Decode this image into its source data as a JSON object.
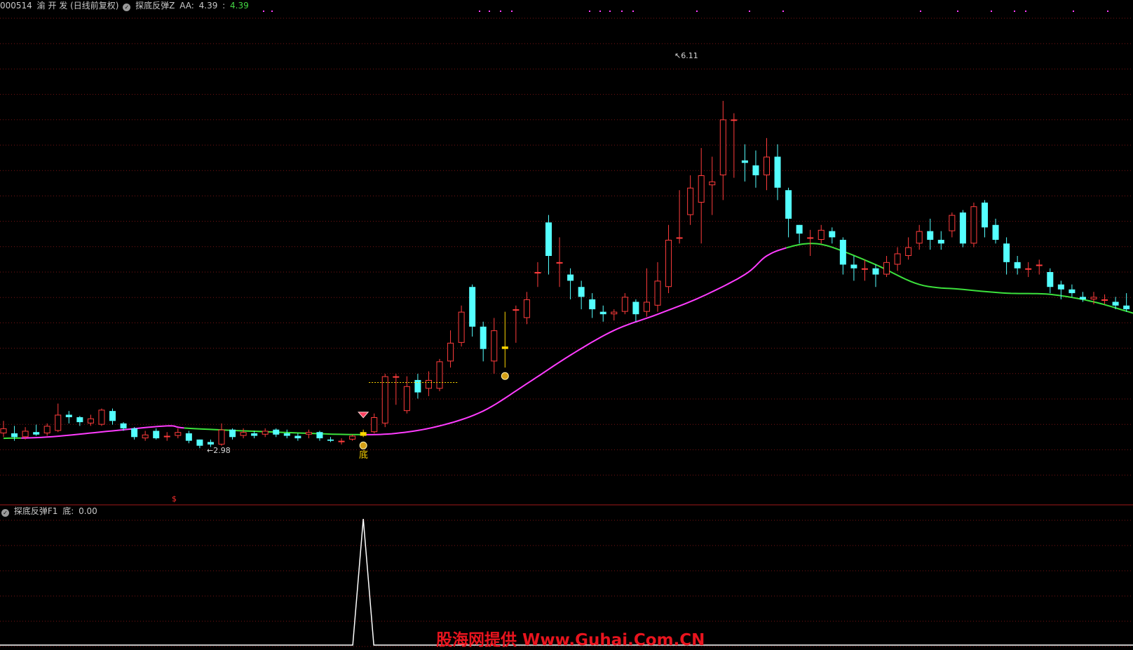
{
  "header": {
    "code": "000514",
    "name": "渝 开 发",
    "mode": "(日线前复权)",
    "indicator": "探底反弹Z",
    "aa_label": "AA:",
    "aa_value1": "4.39",
    "aa_value2": "4.39"
  },
  "subheader": {
    "indicator": "探底反弹F1",
    "label": "底:",
    "value": "0.00"
  },
  "annotations": {
    "high": "6.11",
    "low": "2.98",
    "signal_char": "底",
    "dollar": "$"
  },
  "watermark": "股海网提供 Www.Guhai.Com.CN",
  "colors": {
    "up": "#ff3c3c",
    "down": "#54ffff",
    "signal": "#ffd700",
    "ma_up": "#ff3cff",
    "ma_down": "#3ce13c",
    "grid": "#7a1414",
    "indicator_line": "#ffffff"
  },
  "chart_data": {
    "type": "candlestick",
    "price_range": [
      2.5,
      6.4
    ],
    "candles": [
      [
        3.02,
        3.06,
        3.12,
        2.99
      ],
      [
        3.02,
        2.99,
        3.08,
        2.96
      ],
      [
        2.99,
        3.04,
        3.07,
        2.97
      ],
      [
        3.03,
        3.01,
        3.09,
        3.0
      ],
      [
        3.02,
        3.08,
        3.1,
        3.0
      ],
      [
        3.04,
        3.17,
        3.26,
        3.03
      ],
      [
        3.17,
        3.15,
        3.2,
        3.1
      ],
      [
        3.15,
        3.11,
        3.16,
        3.08
      ],
      [
        3.1,
        3.14,
        3.17,
        3.08
      ],
      [
        3.09,
        3.21,
        3.22,
        3.08
      ],
      [
        3.2,
        3.12,
        3.22,
        3.09
      ],
      [
        3.1,
        3.06,
        3.11,
        3.04
      ],
      [
        3.06,
        2.99,
        3.07,
        2.97
      ],
      [
        2.98,
        3.01,
        3.04,
        2.96
      ],
      [
        3.04,
        2.98,
        3.06,
        2.97
      ],
      [
        2.99,
        3.0,
        3.03,
        2.96
      ],
      [
        3.0,
        3.03,
        3.06,
        2.98
      ],
      [
        3.02,
        2.96,
        3.04,
        2.94
      ],
      [
        2.97,
        2.92,
        2.97,
        2.9
      ],
      [
        2.95,
        2.93,
        2.97,
        2.91
      ],
      [
        2.93,
        3.05,
        3.1,
        2.92
      ],
      [
        3.05,
        2.99,
        3.06,
        2.97
      ],
      [
        3.0,
        3.03,
        3.06,
        2.98
      ],
      [
        3.02,
        3.0,
        3.04,
        2.98
      ],
      [
        3.01,
        3.04,
        3.06,
        2.99
      ],
      [
        3.05,
        3.01,
        3.06,
        2.99
      ],
      [
        3.02,
        3.0,
        3.05,
        2.98
      ],
      [
        3.0,
        2.98,
        3.02,
        2.96
      ],
      [
        3.01,
        3.03,
        3.05,
        2.98
      ],
      [
        3.03,
        2.98,
        3.04,
        2.96
      ],
      [
        2.97,
        2.96,
        2.99,
        2.95
      ],
      [
        2.96,
        2.96,
        2.98,
        2.93
      ],
      [
        2.97,
        3.0,
        3.01,
        2.96
      ],
      [
        3.0,
        3.03,
        3.05,
        2.99
      ],
      [
        3.03,
        3.15,
        3.18,
        3.02
      ],
      [
        3.1,
        3.48,
        3.5,
        3.07
      ],
      [
        3.48,
        3.48,
        3.5,
        3.25
      ],
      [
        3.2,
        3.4,
        3.48,
        3.18
      ],
      [
        3.45,
        3.35,
        3.5,
        3.3
      ],
      [
        3.38,
        3.45,
        3.52,
        3.32
      ],
      [
        3.38,
        3.6,
        3.62,
        3.36
      ],
      [
        3.6,
        3.75,
        3.85,
        3.55
      ],
      [
        3.75,
        4.0,
        4.05,
        3.72
      ],
      [
        4.2,
        3.88,
        4.22,
        3.8
      ],
      [
        3.88,
        3.7,
        3.92,
        3.6
      ],
      [
        3.6,
        3.85,
        3.95,
        3.5
      ],
      [
        3.72,
        3.7,
        4.0,
        3.55
      ],
      [
        4.02,
        4.02,
        4.05,
        3.75
      ],
      [
        3.95,
        4.1,
        4.16,
        3.9
      ],
      [
        4.32,
        4.32,
        4.4,
        4.2
      ],
      [
        4.72,
        4.45,
        4.78,
        4.3
      ],
      [
        4.4,
        4.4,
        4.6,
        4.2
      ],
      [
        4.3,
        4.25,
        4.35,
        4.1
      ],
      [
        4.2,
        4.12,
        4.25,
        4.02
      ],
      [
        4.1,
        4.02,
        4.15,
        3.95
      ],
      [
        4.0,
        3.98,
        4.05,
        3.92
      ],
      [
        3.98,
        4.0,
        4.02,
        3.93
      ],
      [
        4.0,
        4.12,
        4.15,
        3.98
      ],
      [
        4.08,
        3.98,
        4.1,
        3.92
      ],
      [
        4.0,
        4.08,
        4.35,
        3.96
      ],
      [
        4.05,
        4.25,
        4.4,
        4.0
      ],
      [
        4.2,
        4.58,
        4.7,
        4.15
      ],
      [
        4.6,
        4.6,
        4.98,
        4.55
      ],
      [
        4.78,
        5.0,
        5.1,
        4.7
      ],
      [
        4.88,
        5.1,
        5.32,
        4.55
      ],
      [
        5.02,
        5.05,
        5.25,
        4.78
      ],
      [
        5.1,
        5.55,
        5.7,
        4.9
      ],
      [
        5.55,
        5.55,
        5.6,
        5.08
      ],
      [
        5.22,
        5.2,
        5.35,
        5.05
      ],
      [
        5.18,
        5.1,
        5.3,
        5.0
      ],
      [
        5.1,
        5.25,
        5.4,
        4.98
      ],
      [
        5.25,
        5.0,
        5.35,
        4.9
      ],
      [
        4.98,
        4.75,
        5.0,
        4.6
      ],
      [
        4.7,
        4.63,
        4.7,
        4.55
      ],
      [
        4.6,
        4.6,
        4.66,
        4.45
      ],
      [
        4.58,
        4.66,
        4.7,
        4.55
      ],
      [
        4.65,
        4.6,
        4.68,
        4.55
      ],
      [
        4.58,
        4.38,
        4.6,
        4.3
      ],
      [
        4.38,
        4.35,
        4.45,
        4.25
      ],
      [
        4.35,
        4.35,
        4.42,
        4.25
      ],
      [
        4.35,
        4.3,
        4.38,
        4.2
      ],
      [
        4.3,
        4.4,
        4.45,
        4.28
      ],
      [
        4.38,
        4.47,
        4.52,
        4.33
      ],
      [
        4.45,
        4.52,
        4.6,
        4.42
      ],
      [
        4.55,
        4.65,
        4.7,
        4.5
      ],
      [
        4.65,
        4.58,
        4.75,
        4.5
      ],
      [
        4.58,
        4.55,
        4.65,
        4.5
      ],
      [
        4.65,
        4.78,
        4.8,
        4.6
      ],
      [
        4.8,
        4.55,
        4.82,
        4.52
      ],
      [
        4.55,
        4.85,
        4.88,
        4.52
      ],
      [
        4.88,
        4.68,
        4.9,
        4.6
      ],
      [
        4.7,
        4.58,
        4.75,
        4.55
      ],
      [
        4.55,
        4.4,
        4.6,
        4.3
      ],
      [
        4.4,
        4.35,
        4.45,
        4.3
      ],
      [
        4.35,
        4.35,
        4.4,
        4.28
      ],
      [
        4.38,
        4.38,
        4.42,
        4.3
      ],
      [
        4.32,
        4.2,
        4.35,
        4.15
      ],
      [
        4.22,
        4.18,
        4.25,
        4.1
      ],
      [
        4.18,
        4.15,
        4.22,
        4.12
      ],
      [
        4.12,
        4.1,
        4.16,
        4.08
      ],
      [
        4.1,
        4.12,
        4.16,
        4.06
      ],
      [
        4.1,
        4.1,
        4.14,
        4.06
      ],
      [
        4.08,
        4.05,
        4.12,
        4.02
      ],
      [
        4.05,
        4.02,
        4.15,
        4.0
      ],
      [
        4.02,
        3.9,
        4.05,
        3.85
      ],
      [
        3.9,
        3.88,
        3.92,
        3.82
      ],
      [
        3.88,
        3.95,
        3.97,
        3.85
      ]
    ],
    "ma_points": [
      [
        0,
        2.98
      ],
      [
        4,
        2.99
      ],
      [
        10,
        3.04
      ],
      [
        15,
        3.08
      ],
      [
        17,
        3.06
      ],
      [
        25,
        3.03
      ],
      [
        32,
        3.01
      ],
      [
        36,
        3.02
      ],
      [
        40,
        3.08
      ],
      [
        44,
        3.2
      ],
      [
        48,
        3.42
      ],
      [
        52,
        3.65
      ],
      [
        56,
        3.85
      ],
      [
        60,
        3.98
      ],
      [
        64,
        4.12
      ],
      [
        68,
        4.3
      ],
      [
        70,
        4.45
      ],
      [
        72,
        4.52
      ],
      [
        74,
        4.55
      ],
      [
        76,
        4.52
      ],
      [
        80,
        4.38
      ],
      [
        84,
        4.22
      ],
      [
        88,
        4.18
      ],
      [
        92,
        4.15
      ],
      [
        96,
        4.14
      ],
      [
        100,
        4.08
      ],
      [
        104,
        3.98
      ],
      [
        108,
        3.9
      ]
    ],
    "ma_split_index": [
      17,
      33,
      72
    ],
    "signal_candles": [
      33,
      46
    ],
    "indicator": {
      "spike_index": 33,
      "spike_height": 1.0
    }
  }
}
